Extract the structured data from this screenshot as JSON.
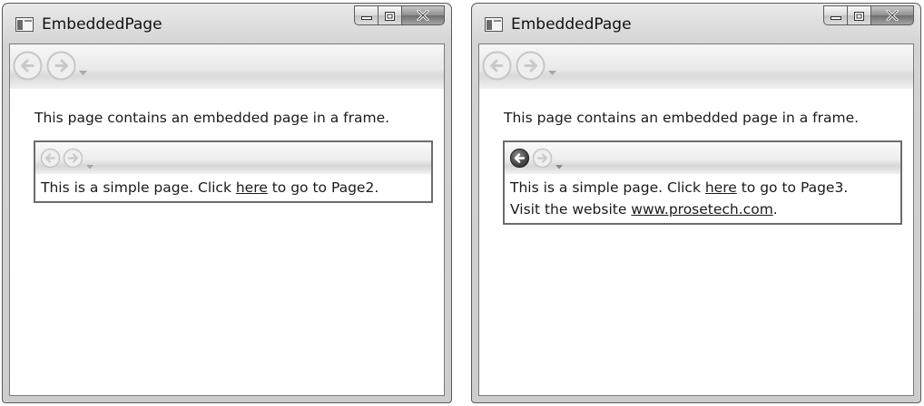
{
  "windows": [
    {
      "title": "EmbeddedPage",
      "main_text": "This page contains an embedded page in a frame.",
      "frame": {
        "back_enabled": false,
        "line1_pre": "This is a simple page. Click ",
        "line1_link": "here",
        "line1_post": " to go to Page2.",
        "line2_pre": "",
        "line2_link": "",
        "line2_post": ""
      }
    },
    {
      "title": "EmbeddedPage",
      "main_text": "This page contains an embedded page in a frame.",
      "frame": {
        "back_enabled": true,
        "line1_pre": "This is a simple page. Click ",
        "line1_link": "here",
        "line1_post": " to go to Page3.",
        "line2_pre": "Visit the website ",
        "line2_link": "www.prosetech.com",
        "line2_post": "."
      }
    }
  ],
  "icons": {
    "app": "window-app-icon",
    "minimize": "minimize-icon",
    "maximize": "maximize-icon",
    "close": "close-icon",
    "back": "back-arrow-icon",
    "forward": "forward-arrow-icon",
    "dropdown": "chevron-down-icon"
  },
  "colors": {
    "chrome": "#d4d4d4",
    "border": "#5a5a5a",
    "disabled_arrow": "#c8c8c8",
    "enabled_arrow": "#4a4a4a"
  }
}
